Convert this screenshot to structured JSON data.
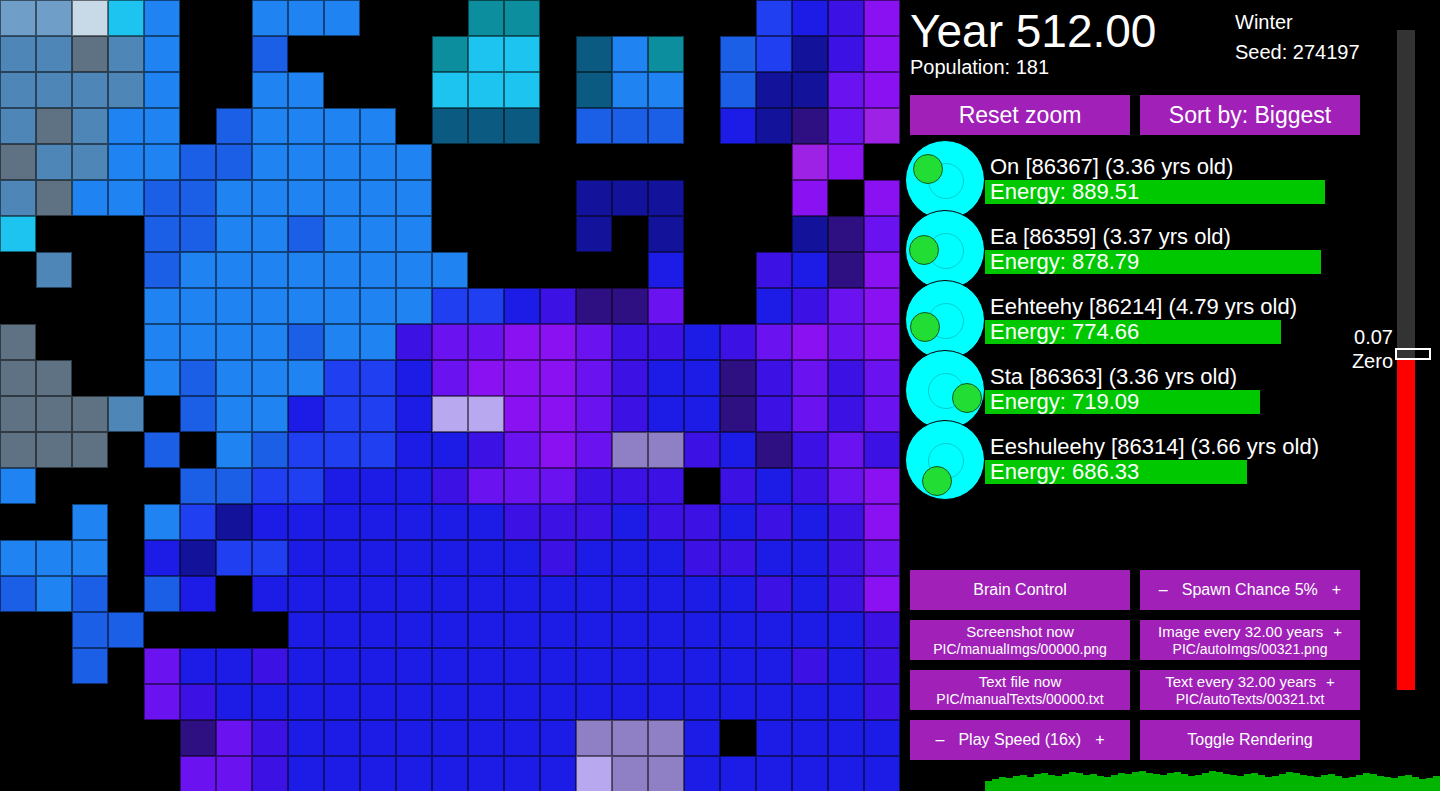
{
  "map": {
    "palette": {
      "a": "#6f9fc8",
      "A": "#c8dae8",
      "b": "#4f86b8",
      "c": "#5f7284",
      "d": "#1ec4f0",
      "e": "#0d8e9e",
      "f": "#0a5a82",
      "g": "#1f84f2",
      "h": "#1a5fe6",
      "i": "#1f3ff0",
      "j": "#1c1ce6",
      "k": "#12129a",
      "l": "#3c12e4",
      "m": "#6a12f0",
      "n": "#8a12f2",
      "o": "#9e22e6",
      "p": "#b8a8f0",
      "q": "#8f7fc4",
      "r": "#2e1082"
    },
    "rows": [
      "aaAdg..ggg...ee......ijln",
      "bbcbg..h....edd.fge.hikln",
      "bbbbg..gg...ddd.fgg.hkkmn",
      "bcbgg.hgggg.fff.hhh.jkrmo",
      "cbbgghhggggg..........on.",
      "bcgghhgggggg....kkk...n.n",
      "d...hhgghggg....k.k...krm",
      ".b..hgggggggg.....j..ljrn",
      "....ggggggggiijlrrm..jlmn",
      "c...gggghgglmmnnmlljlmnmn",
      "cc..ghgggiijmnnnmljjrlmlm",
      "cccb.hggjiijppnnmljjrlmlm",
      "ccc.h.ghiiijjlmnmqqljrlml",
      "g....hhiijjjlmmmlll.ljlmn",
      "..g.gikjjjjjjjllljlljljln",
      "ggg.jkiijjjjjjjljjjlljjlm",
      "hgh.hj.jjjjjjjjjjjjjjljln",
      "..hh....jjjjjjjjjjjjjjjjl",
      "..h.mjjljjjjjjjjjjjjjjljl",
      "....mljjjjjjjjjjjjjjjjjjl",
      ".....rmljjjjjjjjqqqj.jjjj",
      ".....mmljjjjjjjjpqqjjjjjj"
    ]
  },
  "header": {
    "year": "Year 512.00",
    "population": "Population: 181",
    "season": "Winter",
    "seed": "Seed: 274197"
  },
  "top_buttons": [
    "Reset zoom",
    "Sort by: Biggest"
  ],
  "creatures": [
    {
      "label": "On [86367] (3.36 yrs old)",
      "energy": "Energy: 889.51",
      "level": 0.85,
      "heading": 213
    },
    {
      "label": "Ea [86359] (3.37 yrs old)",
      "energy": "Energy: 878.79",
      "level": 0.84,
      "heading": 182
    },
    {
      "label": "Eehteehy [86214] (4.79 yrs old)",
      "energy": "Energy: 774.66",
      "level": 0.74,
      "heading": 165
    },
    {
      "label": "Sta [86363] (3.36 yrs old)",
      "energy": "Energy: 719.09",
      "level": 0.6875,
      "heading": 18
    },
    {
      "label": "Eeshuleehy [86314] (3.66 yrs old)",
      "energy": "Energy: 686.33",
      "level": 0.655,
      "heading": 113
    }
  ],
  "controls": [
    {
      "kind": "single",
      "label": "Brain Control"
    },
    {
      "kind": "stepper",
      "minus": "–",
      "label": "Spawn Chance 5%",
      "plus": "+"
    },
    {
      "kind": "double",
      "label": "Screenshot now",
      "plus": "",
      "path": "PIC/manualImgs/00000.png"
    },
    {
      "kind": "double",
      "label": "Image every 32.00 years",
      "plus": "+",
      "path": "PIC/autoImgs/00321.png"
    },
    {
      "kind": "double",
      "label": "Text file now",
      "plus": "",
      "path": "PIC/manualTexts/00000.txt"
    },
    {
      "kind": "double",
      "label": "Text every 32.00 years",
      "plus": "+",
      "path": "PIC/autoTexts/00321.txt"
    },
    {
      "kind": "stepper",
      "minus": "–",
      "label": "Play Speed (16x)",
      "plus": "+"
    },
    {
      "kind": "single",
      "label": "Toggle Rendering"
    }
  ],
  "gauge": {
    "level": 0.5,
    "labels": [
      "0.07",
      "Zero"
    ]
  },
  "population_graph": {
    "values": [
      10,
      12,
      14,
      13,
      15,
      16,
      14,
      17,
      18,
      16,
      15,
      17,
      19,
      18,
      16,
      17,
      15,
      14,
      16,
      18,
      17,
      19,
      20,
      18,
      17,
      16,
      18,
      19,
      17,
      15,
      16,
      18,
      20,
      19,
      17,
      16,
      15,
      17,
      18,
      16,
      14,
      15,
      17,
      19,
      18,
      16,
      15,
      14,
      16,
      17,
      15,
      13,
      14,
      16,
      18,
      17,
      15,
      14,
      13,
      15,
      16,
      14,
      12,
      13,
      15
    ]
  }
}
